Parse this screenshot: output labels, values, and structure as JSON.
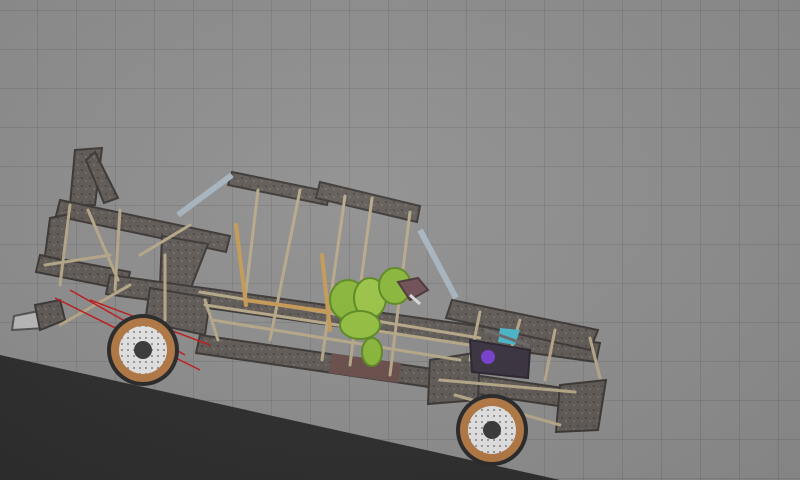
{
  "scene": {
    "background_color": "#8f8f8f",
    "grid_line_color": "#7d7d7d",
    "ground_color": "#2e2e2e",
    "objects": [
      {
        "name": "sandbox-ground-slope",
        "kind": "terrain"
      },
      {
        "name": "scrap-vehicle-frame",
        "kind": "vehicle"
      },
      {
        "name": "green-ragdoll-character",
        "kind": "character"
      },
      {
        "name": "front-wheel",
        "kind": "wheel"
      },
      {
        "name": "rear-wheel",
        "kind": "wheel"
      },
      {
        "name": "purple-thruster-engine",
        "kind": "engine"
      }
    ]
  }
}
